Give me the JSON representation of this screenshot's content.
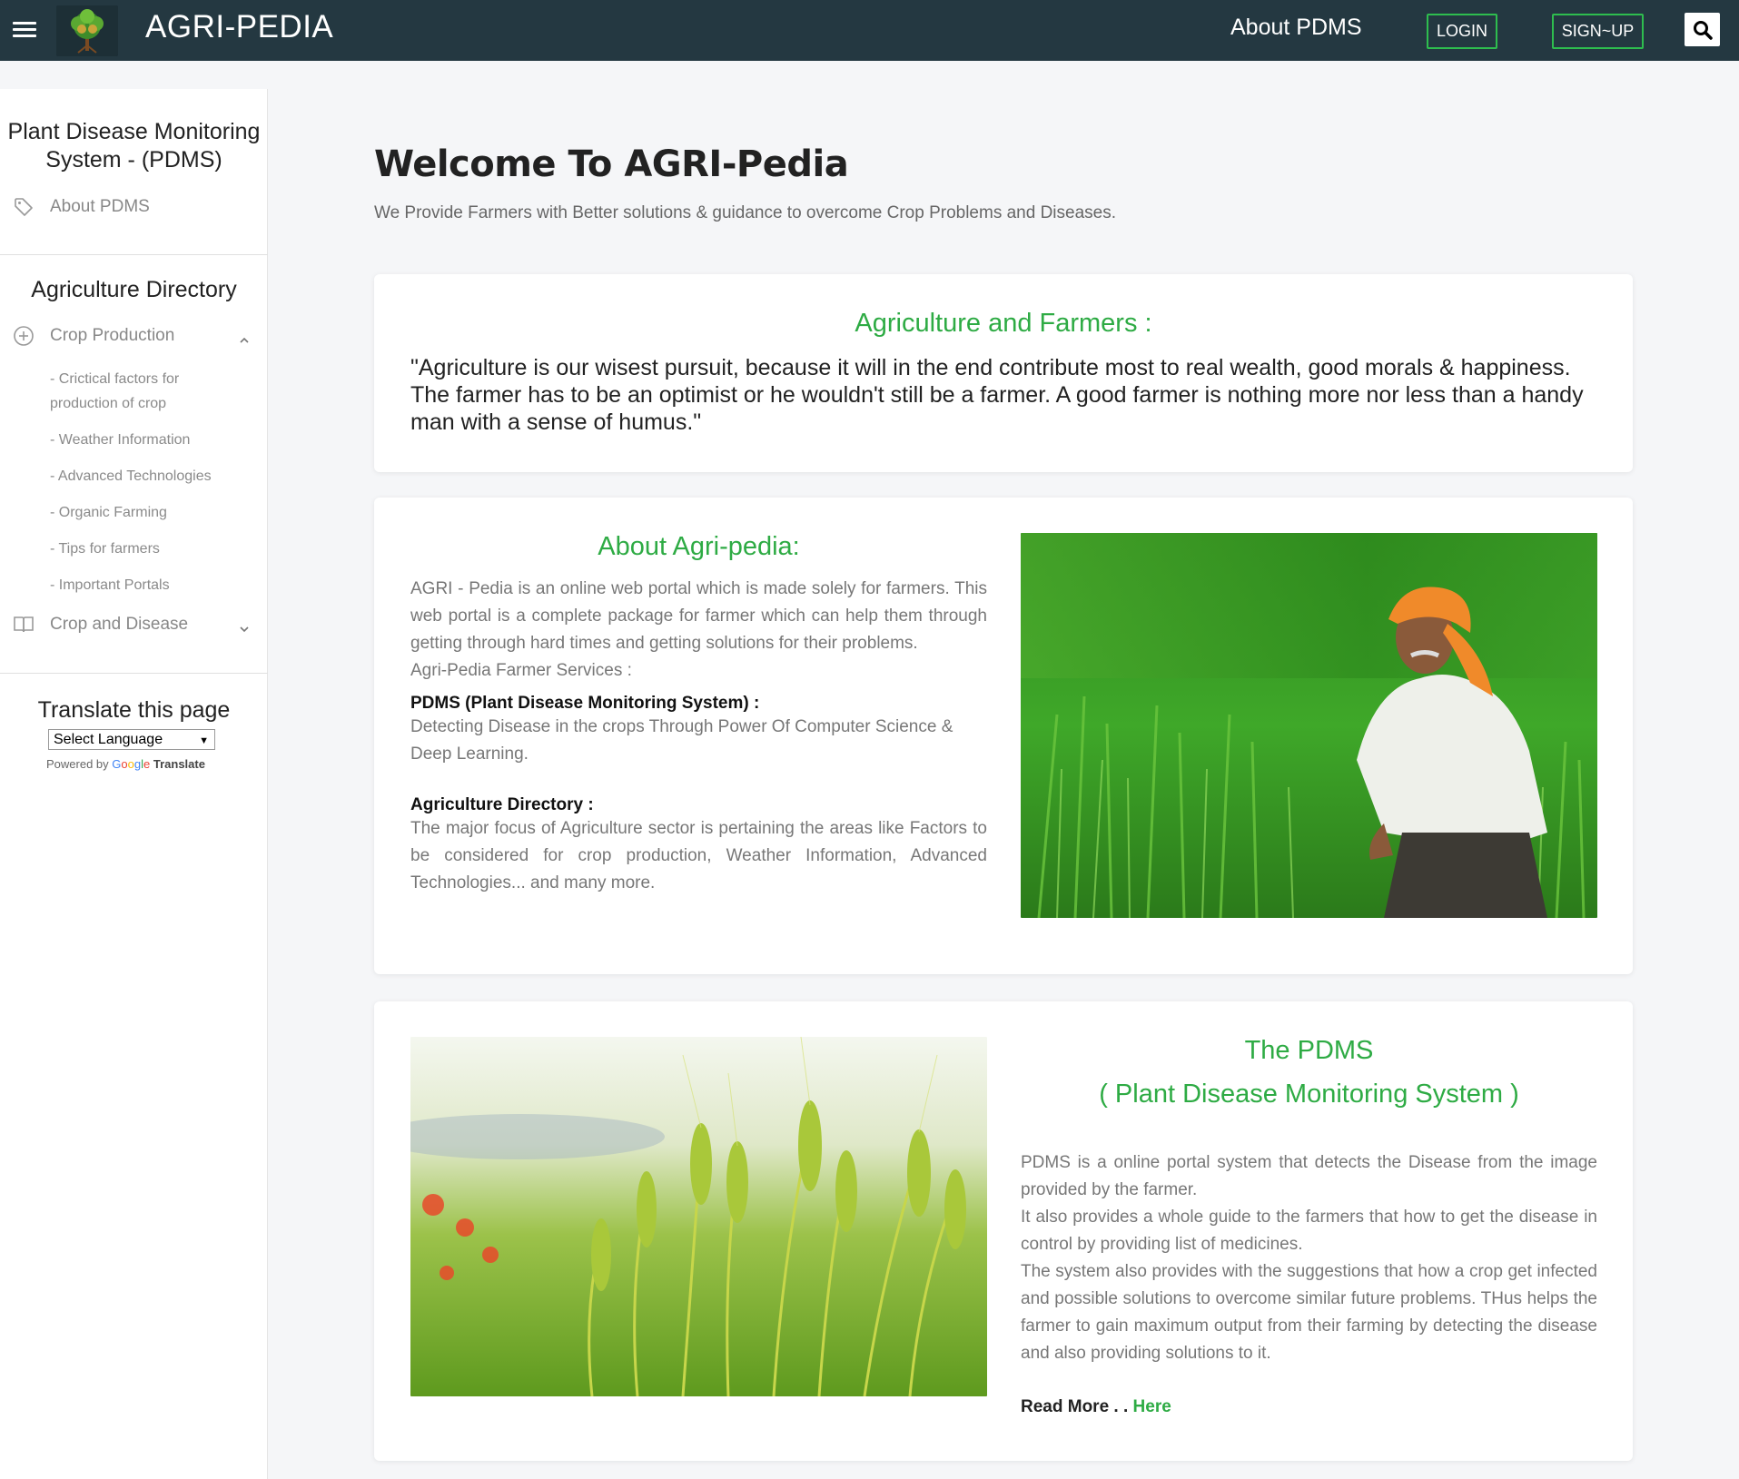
{
  "header": {
    "brand": "AGRI-PEDIA",
    "about_label": "About PDMS",
    "login_label": "LOGIN",
    "signup_label": "SIGN~UP"
  },
  "sidebar": {
    "title": "Plant Disease Monitoring System - (PDMS)",
    "about_item": "About PDMS",
    "directory_heading": "Agriculture Directory",
    "crop_production": "Crop Production",
    "sub_items": [
      "- Crictical factors for production of crop",
      "- Weather Information",
      "- Advanced Technologies",
      "- Organic Farming",
      "- Tips for farmers",
      "- Important Portals"
    ],
    "crop_disease": "Crop and Disease",
    "translate_title": "Translate this page",
    "select_language": "Select Language",
    "powered_by": "Powered by",
    "google": "Google",
    "translate": "Translate"
  },
  "main": {
    "welcome": "Welcome To AGRI-Pedia",
    "subtitle": "We Provide Farmers with Better solutions & guidance to overcome Crop Problems and Diseases.",
    "card1": {
      "heading": "Agriculture and Farmers :",
      "quote": "\"Agriculture is our wisest pursuit, because it will in the end contribute most to real wealth, good morals & happiness. The farmer has to be an optimist or he wouldn't still be a farmer. A good farmer is nothing more nor less than a handy man with a sense of humus.\""
    },
    "card2": {
      "heading": "About Agri-pedia:",
      "para1": "AGRI - Pedia is an online web portal which is made solely for farmers. This web portal is a complete package for farmer which can help them through getting through hard times and getting solutions for their problems.",
      "services": "Agri-Pedia Farmer Services :",
      "pdms_title": "PDMS (Plant Disease Monitoring System) :",
      "pdms_text": "Detecting Disease in the crops Through Power Of Computer Science & Deep Learning.",
      "dir_title": "Agriculture Directory :",
      "dir_text": "The major focus of Agriculture sector is pertaining the areas like Factors to be considered for crop production, Weather Information, Advanced Technologies... and many more."
    },
    "card3": {
      "heading1": "The PDMS",
      "heading2": "( Plant Disease Monitoring System )",
      "para1": "PDMS is a online portal system that detects the Disease from the image provided by the farmer.",
      "para2": "It also provides a whole guide to the farmers that how to get the disease in control by providing list of medicines.",
      "para3": "The system also provides with the suggestions that how a crop get infected and possible solutions to overcome similar future problems. THus helps the farmer to gain maximum output from their farming by detecting the disease and also providing solutions to it.",
      "read_more": "Read More . .",
      "here": "Here"
    }
  },
  "colors": {
    "topbar": "#243841",
    "accent_green": "#2eab44",
    "button_border": "#2ebd4e"
  }
}
